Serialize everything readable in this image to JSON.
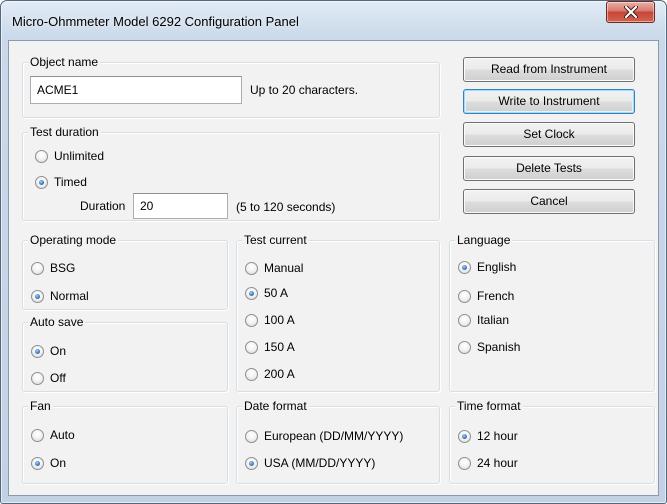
{
  "window": {
    "title": "Micro-Ohmmeter Model 6292 Configuration Panel"
  },
  "icons": {
    "close": "close-icon"
  },
  "colors": {
    "accent": "#1b5fb0",
    "focus_border": "#3c7fb1",
    "close_button": "#c7463a"
  },
  "object_name": {
    "label": "Object name",
    "value": "ACME1",
    "hint": "Up to 20 characters."
  },
  "test_duration": {
    "label": "Test duration",
    "options": [
      {
        "label": "Unlimited",
        "checked": false
      },
      {
        "label": "Timed",
        "checked": true
      }
    ],
    "duration_label": "Duration",
    "duration_value": "20",
    "duration_hint": "(5 to 120 seconds)"
  },
  "buttons": {
    "read": "Read from Instrument",
    "write": "Write to Instrument",
    "set_clock": "Set Clock",
    "delete_tests": "Delete Tests",
    "cancel": "Cancel"
  },
  "operating_mode": {
    "label": "Operating mode",
    "options": [
      {
        "label": "BSG",
        "checked": false
      },
      {
        "label": "Normal",
        "checked": true
      }
    ]
  },
  "auto_save": {
    "label": "Auto save",
    "options": [
      {
        "label": "On",
        "checked": true
      },
      {
        "label": "Off",
        "checked": false
      }
    ]
  },
  "fan": {
    "label": "Fan",
    "options": [
      {
        "label": "Auto",
        "checked": false
      },
      {
        "label": "On",
        "checked": true
      }
    ]
  },
  "test_current": {
    "label": "Test current",
    "options": [
      {
        "label": "Manual",
        "checked": false
      },
      {
        "label": "50 A",
        "checked": true
      },
      {
        "label": "100 A",
        "checked": false
      },
      {
        "label": "150 A",
        "checked": false
      },
      {
        "label": "200 A",
        "checked": false
      }
    ]
  },
  "date_format": {
    "label": "Date format",
    "options": [
      {
        "label": "European (DD/MM/YYYY)",
        "checked": false
      },
      {
        "label": "USA (MM/DD/YYYY)",
        "checked": true
      }
    ]
  },
  "language": {
    "label": "Language",
    "options": [
      {
        "label": "English",
        "checked": true
      },
      {
        "label": "French",
        "checked": false
      },
      {
        "label": "Italian",
        "checked": false
      },
      {
        "label": "Spanish",
        "checked": false
      }
    ]
  },
  "time_format": {
    "label": "Time format",
    "options": [
      {
        "label": "12 hour",
        "checked": true
      },
      {
        "label": "24 hour",
        "checked": false
      }
    ]
  }
}
